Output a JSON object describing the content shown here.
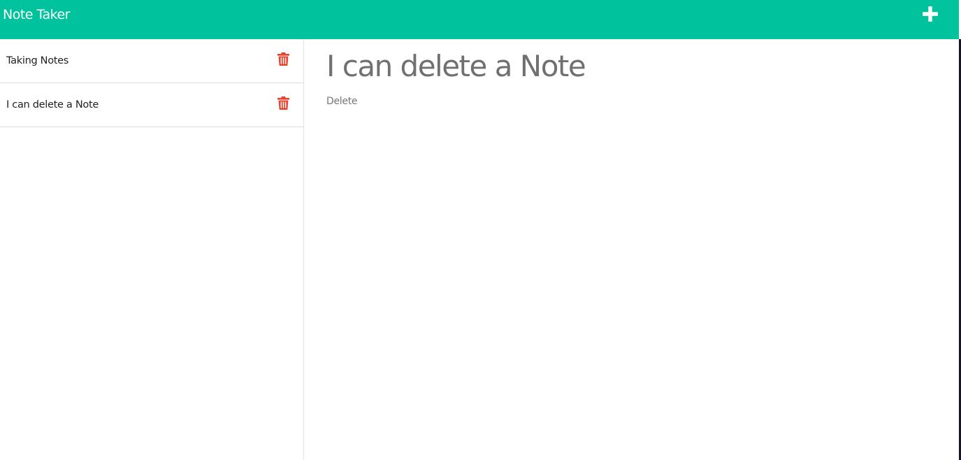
{
  "header": {
    "brand": "Note Taker",
    "new_note_icon": "plus-icon"
  },
  "colors": {
    "header_bg": "#00c39e",
    "delete_icon": "#e8412c",
    "heading_text": "#707070"
  },
  "sidebar": {
    "items": [
      {
        "title": "Taking Notes",
        "icon": "trash-icon"
      },
      {
        "title": "I can delete a Note",
        "icon": "trash-icon"
      }
    ]
  },
  "main": {
    "note_title": "I can delete a Note",
    "note_text": "Delete"
  }
}
